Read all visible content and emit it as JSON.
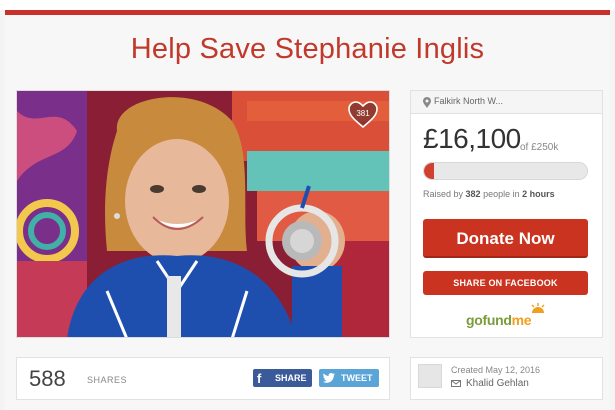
{
  "campaign": {
    "title": "Help Save Stephanie Inglis",
    "hearts": "381"
  },
  "sidebar": {
    "location": "Falkirk North W...",
    "amount": "£16,100",
    "goal": "of £250k",
    "progress_fraction": 0.0644,
    "raised_prefix": "Raised by ",
    "raised_count": "382",
    "raised_middle": " people in ",
    "raised_time": "2 hours",
    "donate_label": "Donate Now",
    "share_facebook_label": "SHARE ON FACEBOOK",
    "logo": {
      "go": "go",
      "fund": "fund",
      "me": "me"
    }
  },
  "share": {
    "count": "588",
    "label": "SHARES",
    "facebook_label": "SHARE",
    "twitter_label": "TWEET"
  },
  "organizer": {
    "created": "Created May 12, 2016",
    "name": "Khalid Gehlan"
  },
  "colors": {
    "brand_red": "#c9331f",
    "title_red": "#c0392b",
    "facebook_blue": "#3b5a9a",
    "twitter_blue": "#5aa4d8",
    "gofundme_green": "#7a9c3a",
    "gofundme_orange": "#f0a020"
  }
}
